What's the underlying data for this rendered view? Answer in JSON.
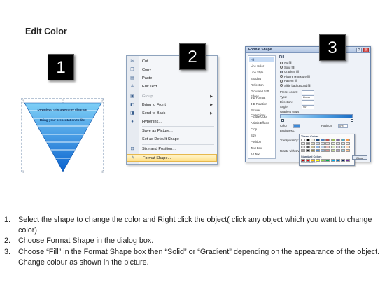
{
  "title": "Edit Color",
  "badges": {
    "one": "1",
    "two": "2",
    "three": "3"
  },
  "panel1": {
    "line1": "Download this awesome diagram",
    "line2": "Bring your presentation to life",
    "colors": {
      "light": "#6fc4f2",
      "mid": "#2a8fe0",
      "dark": "#0a5bc4"
    }
  },
  "context_menu": {
    "items": [
      {
        "label": "Cut",
        "icon": "scissors-icon",
        "glyph": "✂",
        "disabled": false,
        "submenu": false
      },
      {
        "label": "Copy",
        "icon": "copy-icon",
        "glyph": "❐",
        "disabled": false,
        "submenu": false
      },
      {
        "label": "Paste",
        "icon": "paste-icon",
        "glyph": "▤",
        "disabled": false,
        "submenu": false
      },
      {
        "label": "Edit Text",
        "icon": "edit-text-icon",
        "glyph": "A",
        "disabled": false,
        "submenu": false
      },
      {
        "label": "Group",
        "icon": "group-icon",
        "glyph": "▣",
        "disabled": true,
        "submenu": true
      },
      {
        "label": "Bring to Front",
        "icon": "bring-to-front-icon",
        "glyph": "◧",
        "disabled": false,
        "submenu": true
      },
      {
        "label": "Send to Back",
        "icon": "send-to-back-icon",
        "glyph": "◨",
        "disabled": false,
        "submenu": true
      },
      {
        "label": "Hyperlink...",
        "icon": "hyperlink-icon",
        "glyph": "●",
        "disabled": false,
        "submenu": false
      },
      {
        "label": "Save as Picture...",
        "icon": "",
        "glyph": "",
        "disabled": false,
        "submenu": false
      },
      {
        "label": "Set as Default Shape",
        "icon": "",
        "glyph": "",
        "disabled": false,
        "submenu": false
      },
      {
        "label": "Size and Position...",
        "icon": "size-position-icon",
        "glyph": "⊡",
        "disabled": false,
        "submenu": false
      },
      {
        "label": "Format Shape...",
        "icon": "format-shape-icon",
        "glyph": "✎",
        "disabled": false,
        "submenu": false,
        "highlighted": true
      }
    ]
  },
  "dialog": {
    "title": "Format Shape",
    "help": "?",
    "close": "X",
    "categories": [
      "Fill",
      "Line Color",
      "Line Style",
      "Shadow",
      "Reflection",
      "Glow and Soft Edges",
      "3-D Format",
      "3-D Rotation",
      "Picture Corrections",
      "Picture Color",
      "Artistic Effects",
      "Crop",
      "Size",
      "Position",
      "Text Box",
      "Alt Text"
    ],
    "selected_category": "Fill",
    "pane_title": "Fill",
    "fill_options": [
      {
        "label": "No fill",
        "selected": false
      },
      {
        "label": "Solid fill",
        "selected": false
      },
      {
        "label": "Gradient fill",
        "selected": true
      },
      {
        "label": "Picture or texture fill",
        "selected": false
      },
      {
        "label": "Pattern fill",
        "selected": false
      },
      {
        "label": "Slide background fill",
        "selected": false
      }
    ],
    "fields": [
      {
        "label": "Preset colors:",
        "value": ""
      },
      {
        "label": "Type:",
        "value": "Linear"
      },
      {
        "label": "Direction:",
        "value": ""
      },
      {
        "label": "Angle:",
        "value": "90°"
      }
    ],
    "gradient_stops_label": "Gradient stops",
    "color_label": "Color",
    "position_label": "Position:",
    "position_value": "0%",
    "brightness_label": "Brightness:",
    "transparency_label": "Transparency:",
    "rotate_label": "Rotate with shape",
    "theme_colors_label": "Theme Colors",
    "standard_colors_label": "Standard Colors",
    "more_colors_label": "More Colors...",
    "close_button": "Close",
    "theme_rows": [
      [
        "#ffffff",
        "#000000",
        "#eeece1",
        "#1f497d",
        "#4f81bd",
        "#c0504d",
        "#9bbb59",
        "#8064a2",
        "#4bacc6",
        "#f79646"
      ],
      [
        "#f2f2f2",
        "#7f7f7f",
        "#ddd9c3",
        "#c6d9f0",
        "#dbe5f1",
        "#f2dcdb",
        "#ebf1dd",
        "#e5e0ec",
        "#dbeef3",
        "#fdeada"
      ],
      [
        "#d8d8d8",
        "#595959",
        "#c4bd97",
        "#8db3e2",
        "#b8cce4",
        "#e5b9b7",
        "#d7e3bc",
        "#ccc1d9",
        "#b7dde8",
        "#fbd5b5"
      ],
      [
        "#a5a5a5",
        "#262626",
        "#938953",
        "#548dd4",
        "#95b3d7",
        "#d99694",
        "#c3d69b",
        "#b2a2c7",
        "#92cddc",
        "#fac08f"
      ]
    ],
    "standard_row": [
      "#c00000",
      "#ff0000",
      "#ffc000",
      "#ffff00",
      "#92d050",
      "#00b050",
      "#00b0f0",
      "#0070c0",
      "#002060",
      "#7030a0"
    ]
  },
  "instructions": [
    {
      "num": "1.",
      "text": "Select the shape to change the color and Right click the object( click any object which you want to change color)"
    },
    {
      "num": "2.",
      "text": "Choose Format Shape in the dialog box."
    },
    {
      "num": "3.",
      "text": "Choose “Fill” in the Format Shape box then “Solid” or “Gradient” depending on the appearance of the object. Change colour as shown in the picture."
    }
  ]
}
